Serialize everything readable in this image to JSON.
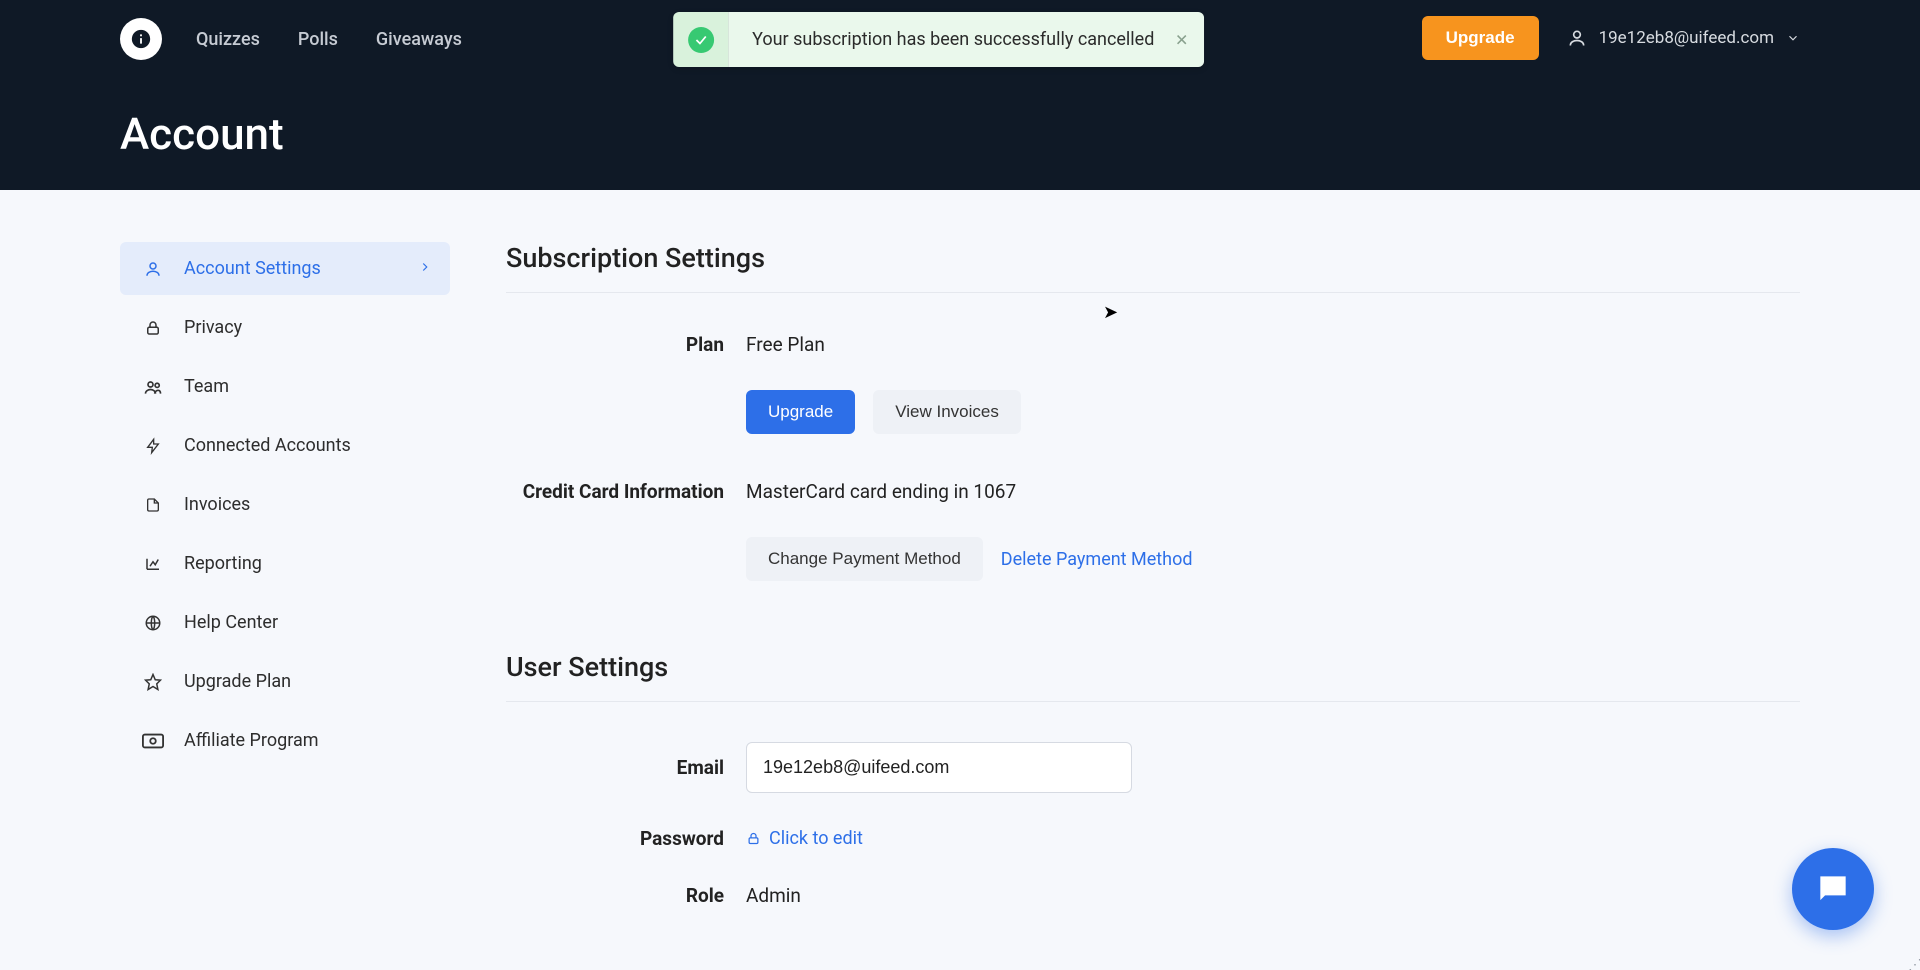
{
  "nav": {
    "items": [
      "Quizzes",
      "Polls",
      "Giveaways"
    ]
  },
  "toast": {
    "message": "Your subscription has been successfully cancelled"
  },
  "topbar": {
    "upgrade": "Upgrade",
    "user_email": "19e12eb8@uifeed.com"
  },
  "page": {
    "title": "Account"
  },
  "sidebar": {
    "items": [
      {
        "label": "Account Settings"
      },
      {
        "label": "Privacy"
      },
      {
        "label": "Team"
      },
      {
        "label": "Connected Accounts"
      },
      {
        "label": "Invoices"
      },
      {
        "label": "Reporting"
      },
      {
        "label": "Help Center"
      },
      {
        "label": "Upgrade Plan"
      },
      {
        "label": "Affiliate Program"
      }
    ]
  },
  "subscription": {
    "title": "Subscription Settings",
    "plan_label": "Plan",
    "plan_value": "Free Plan",
    "upgrade": "Upgrade",
    "view_invoices": "View Invoices",
    "cc_label": "Credit Card Information",
    "cc_value": "MasterCard card ending in 1067",
    "change_payment": "Change Payment Method",
    "delete_payment": "Delete Payment Method"
  },
  "user": {
    "title": "User Settings",
    "email_label": "Email",
    "email_value": "19e12eb8@uifeed.com",
    "password_label": "Password",
    "password_action": "Click to edit",
    "role_label": "Role",
    "role_value": "Admin"
  }
}
